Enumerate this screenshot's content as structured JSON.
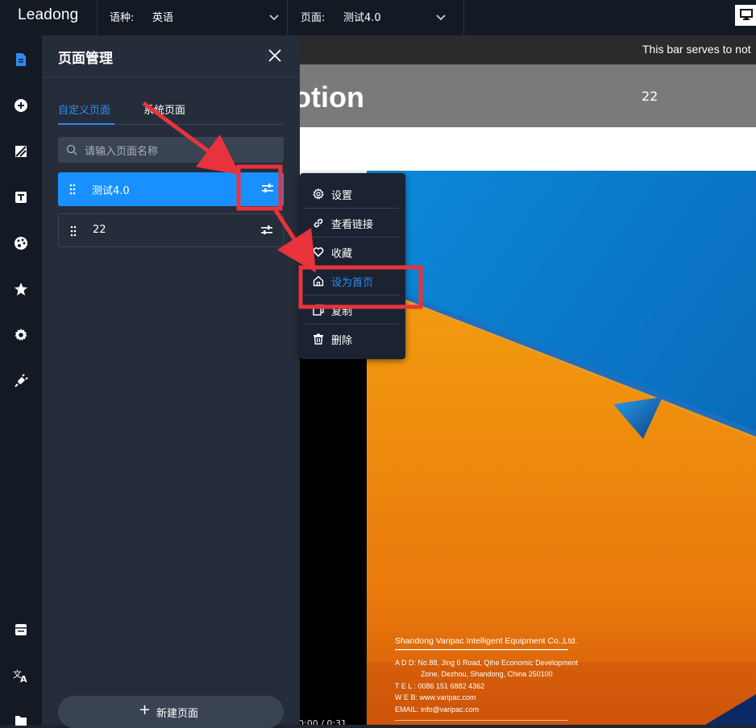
{
  "topbar": {
    "logo": "Leadong",
    "language_label": "语种:",
    "language_value": "英语",
    "page_label": "页面:",
    "page_value": "测试4.0"
  },
  "panel": {
    "title": "页面管理",
    "tabs": [
      {
        "label": "自定义页面",
        "active": true
      },
      {
        "label": "系统页面",
        "active": false
      }
    ],
    "search_placeholder": "请输入页面名称",
    "pages": [
      {
        "name": "测试4.0",
        "selected": true
      },
      {
        "name": "22",
        "selected": false
      }
    ],
    "new_page_label": "新建页面"
  },
  "context_menu": {
    "items": [
      {
        "label": "设置",
        "icon": "gear-icon"
      },
      {
        "label": "查看链接",
        "icon": "link-icon"
      },
      {
        "label": "收藏",
        "icon": "heart-icon"
      },
      {
        "label": "设为首页",
        "icon": "home-icon",
        "highlight": true
      },
      {
        "label": "复制",
        "icon": "copy-icon"
      },
      {
        "label": "删除",
        "icon": "trash-icon"
      }
    ]
  },
  "preview": {
    "notice": "This bar serves to not",
    "hero_title": "otion",
    "hero_number": "22",
    "video_time": "0:00 / 0:31",
    "brochure": {
      "company": "Shandong Varipac Intelligent Equipment Co.,Ltd.",
      "address_1": "A D D: No.88, Jing 6 Road, Qihe Economic Development",
      "address_2": "Zone, Dezhou, Shandong, China 250100",
      "tel": "T E L : 0086 151 6882 4362",
      "web": "W E B: www.varipac.com",
      "email": "EMAIL: info@varipac.com"
    }
  },
  "colors": {
    "accent": "#1890ff",
    "annotation": "#e8333c",
    "panel_bg": "#252d3a",
    "rail_bg": "#141a24"
  }
}
